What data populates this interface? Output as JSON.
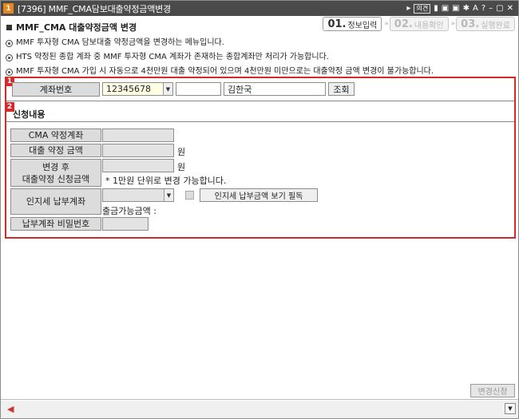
{
  "window": {
    "badge": "1",
    "title": "[7396] MMF_CMA담보대출약정금액변경",
    "tools": [
      "▸",
      "의견",
      "▮",
      "▣",
      "▣",
      "✱",
      "A",
      "?",
      "–",
      "▢",
      "✕"
    ]
  },
  "header": {
    "title": "MMF_CMA 대출약정금액 변경",
    "steps": [
      {
        "num": "01.",
        "label": "정보입력"
      },
      {
        "num": "02.",
        "label": "내용확인"
      },
      {
        "num": "03.",
        "label": "실행완료"
      }
    ],
    "step_arrow": "»",
    "info": [
      "MMF 투자형 CMA 담보대출 약정금액을 변경하는 메뉴입니다.",
      "HTS 약정된 종합 계좌 중 MMF 투자형 CMA 계좌가 존재하는 종합계좌만 처리가 가능합니다.",
      "MMF 투자형 CMA 가입 시 자동으로 4천만원 대출 약정되어 있으며 4천만원 미만으로는 대출약정 금액 변경이 불가능합니다."
    ]
  },
  "account": {
    "marker": "1",
    "label": "계좌번호",
    "number": "12345678",
    "password": "",
    "name": "김한국",
    "query_label": "조회"
  },
  "application": {
    "marker": "2",
    "title": "신청내용",
    "cma_account_label": "CMA 약정계좌",
    "cma_account_value": "",
    "loan_amount_label": "대출 약정 금액",
    "loan_amount_value": "",
    "unit": "원",
    "changed_label_line1": "변경 후",
    "changed_label_line2": "대출약정 신청금액",
    "changed_value": "",
    "note": "* 1만원 단위로 변경 가능합니다.",
    "stamp_account_label": "인지세 납부계좌",
    "stamp_account_value": "",
    "stamp_view_label": "인지세 납부금액 보기 필독",
    "withdrawable_label": "출금가능금액 :",
    "payment_password_label": "납부계좌 비밀번호",
    "payment_password_value": ""
  },
  "footer": {
    "submit_label": "변경신청",
    "speaker": "◀"
  },
  "colors": {
    "titlebar": "#4a4a4a",
    "accent_red": "#d62a2a",
    "badge_orange": "#e7861c",
    "input_yellow": "#fffde3"
  }
}
